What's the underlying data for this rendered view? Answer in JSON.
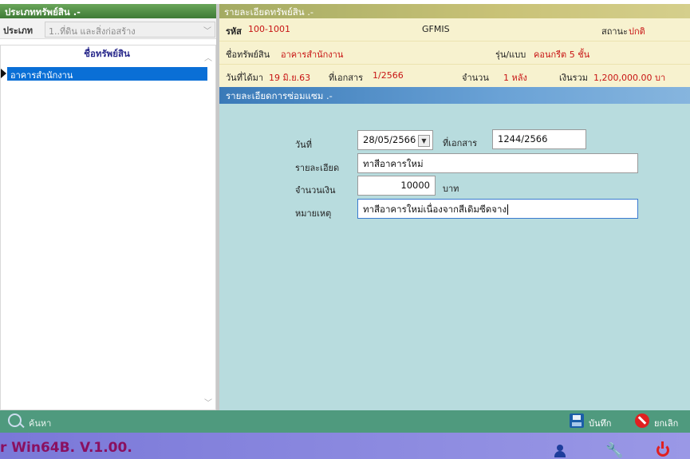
{
  "left_panel": {
    "header": "ประเภททรัพย์สิน .-",
    "type_label": "ประเภท",
    "type_value": "1..ที่ดิน และสิ่งก่อสร้าง",
    "list_header": "ชื่อทรัพย์สิน",
    "items": [
      "อาคารสำนักงาน"
    ],
    "selected_index": 0
  },
  "asset_detail": {
    "header": "รายละเอียดทรัพย์สิน .-",
    "code_label": "รหัส",
    "code_value": "100-1001",
    "gfmis_label": "GFMIS",
    "status_label": "สถานะ",
    "status_value": "ปกติ",
    "name_label": "ชื่อทรัพย์สิน",
    "name_value": "อาคารสำนักงาน",
    "model_label": "รุ่น/แบบ",
    "model_value": "คอนกรีต 5 ชั้น",
    "acquired_label": "วันที่ได้มา",
    "acquired_value": "19 มิ.ย.63",
    "doc_label": "ที่เอกสาร",
    "doc_value": "1/2566",
    "qty_label": "จำนวน",
    "qty_value": "1 หลัง",
    "total_label": "เงินรวม",
    "total_value": "1,200,000.00 บา"
  },
  "repair_detail": {
    "header": "รายละเอียดการซ่อมแซม .-",
    "date_label": "วันที่",
    "date_value": "28/05/2566",
    "doc_label": "ที่เอกสาร",
    "doc_value": "1244/2566",
    "detail_label": "รายละเอียด",
    "detail_value": "ทาสีอาคารใหม่",
    "amount_label": "จำนวนเงิน",
    "amount_value": "10000",
    "amount_unit": "บาท",
    "note_label": "หมายเหตุ",
    "note_value": "ทาสีอาคารใหม่เนื่องจากสีเดิมซีดจาง"
  },
  "toolbar": {
    "search_label": "ค้นหา",
    "save_label": "บันทึก",
    "cancel_label": "ยกเลิก"
  },
  "status_bar": {
    "app_name": "r Win64B. V.1.00."
  },
  "colors": {
    "left_header": "#4a8a40",
    "list_selection": "#0a6fd6",
    "form_background": "#b8dcde",
    "toolbar": "#4f9a7e",
    "status_bar": "#8a88e0",
    "accent_red": "#c81414"
  }
}
